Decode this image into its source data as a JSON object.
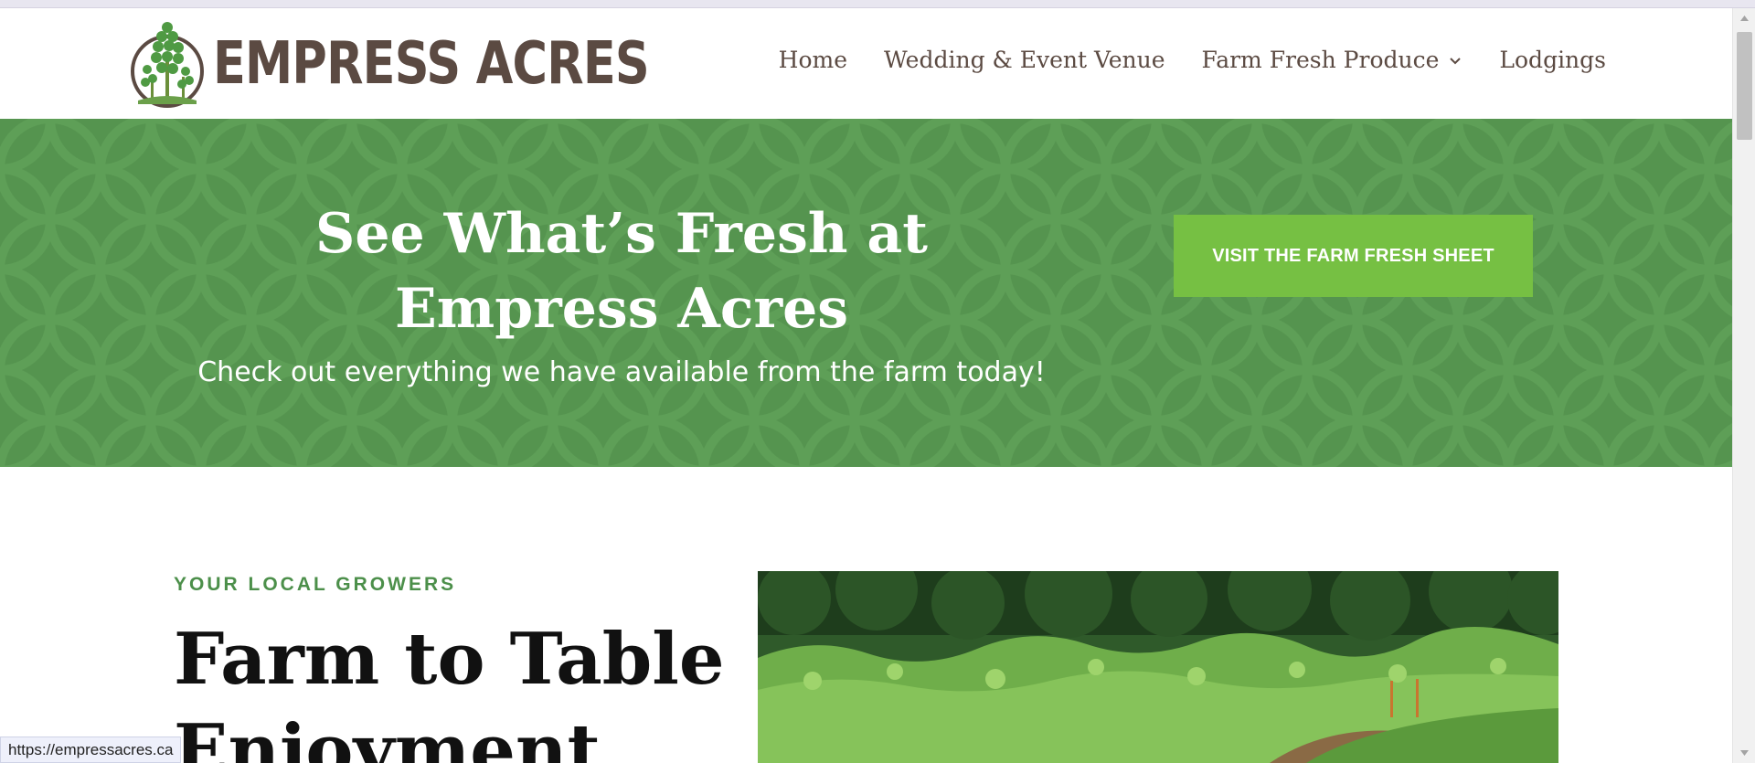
{
  "site": {
    "logo_text": "EMPRESS ACRES",
    "logo_icon": "tree-logo-icon"
  },
  "nav": {
    "items": [
      {
        "label": "Home"
      },
      {
        "label": "Wedding & Event Venue"
      },
      {
        "label": "Farm Fresh Produce",
        "icon": "chevron-down-icon"
      },
      {
        "label": "Lodgings"
      }
    ]
  },
  "banner": {
    "title": "See What’s Fresh at Empress Acres",
    "subtitle": "Check out everything we have available from the farm today!",
    "cta_label": "VISIT THE FARM FRESH SHEET"
  },
  "intro": {
    "eyebrow": "YOUR LOCAL GROWERS",
    "heading": "Farm to Table Enjoyment"
  },
  "status_bar": {
    "url": "https://empressacres.ca"
  },
  "colors": {
    "brand_brown": "#5b4a42",
    "banner_green": "#55944f",
    "cta_green": "#76c043",
    "eyebrow_green": "#4c8f4a"
  }
}
